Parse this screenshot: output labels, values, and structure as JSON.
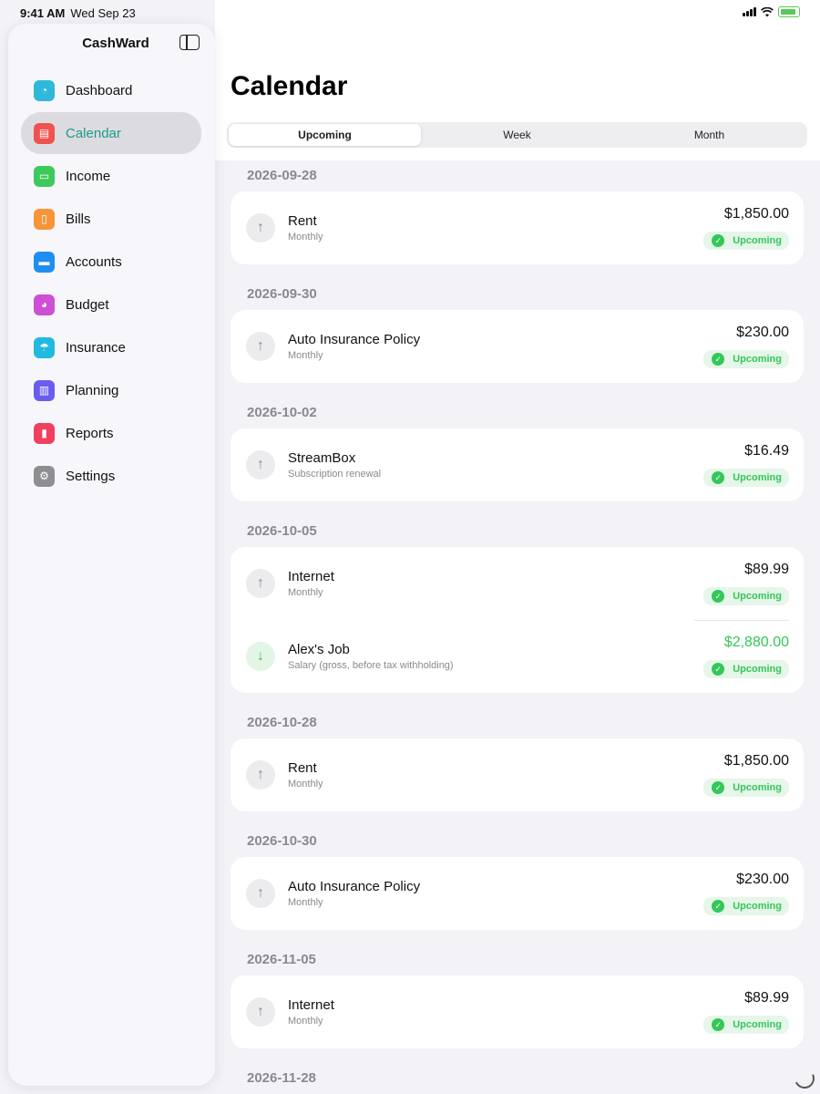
{
  "status": {
    "time": "9:41 AM",
    "date": "Wed Sep 23"
  },
  "app": {
    "name": "CashWard"
  },
  "page": {
    "title": "Calendar"
  },
  "segments": [
    "Upcoming",
    "Week",
    "Month"
  ],
  "selected_segment": "Upcoming",
  "sidebar": {
    "items": [
      {
        "label": "Dashboard",
        "icon": "gauge-icon",
        "color": "#2fb8d9",
        "glyph": "◔"
      },
      {
        "label": "Calendar",
        "icon": "calendar-icon",
        "color": "#f0524f",
        "glyph": "▤",
        "active": true
      },
      {
        "label": "Income",
        "icon": "banknote-icon",
        "color": "#3ec95c",
        "glyph": "▭"
      },
      {
        "label": "Bills",
        "icon": "document-icon",
        "color": "#f7943a",
        "glyph": "▯"
      },
      {
        "label": "Accounts",
        "icon": "credit-card-icon",
        "color": "#1f8ef0",
        "glyph": "▬"
      },
      {
        "label": "Budget",
        "icon": "pie-chart-icon",
        "color": "#cc4fd6",
        "glyph": "◕"
      },
      {
        "label": "Insurance",
        "icon": "umbrella-icon",
        "color": "#22b9e0",
        "glyph": "☂"
      },
      {
        "label": "Planning",
        "icon": "map-icon",
        "color": "#6a5cf0",
        "glyph": "▥"
      },
      {
        "label": "Reports",
        "icon": "bar-chart-icon",
        "color": "#f0405e",
        "glyph": "▮"
      },
      {
        "label": "Settings",
        "icon": "gear-icon",
        "color": "#8e8e93",
        "glyph": "⚙"
      }
    ]
  },
  "sections": [
    {
      "date": "2026-09-28",
      "rows": [
        {
          "name": "Rent",
          "sub": "Monthly",
          "amount": "$1,850.00",
          "status": "Upcoming",
          "direction": "out"
        }
      ]
    },
    {
      "date": "2026-09-30",
      "rows": [
        {
          "name": "Auto Insurance Policy",
          "sub": "Monthly",
          "amount": "$230.00",
          "status": "Upcoming",
          "direction": "out"
        }
      ]
    },
    {
      "date": "2026-10-02",
      "rows": [
        {
          "name": "StreamBox",
          "sub": "Subscription renewal",
          "amount": "$16.49",
          "status": "Upcoming",
          "direction": "out"
        }
      ]
    },
    {
      "date": "2026-10-05",
      "rows": [
        {
          "name": "Internet",
          "sub": "Monthly",
          "amount": "$89.99",
          "status": "Upcoming",
          "direction": "out"
        },
        {
          "name": "Alex's Job",
          "sub": "Salary (gross, before tax withholding)",
          "amount": "$2,880.00",
          "status": "Upcoming",
          "direction": "in"
        }
      ]
    },
    {
      "date": "2026-10-28",
      "rows": [
        {
          "name": "Rent",
          "sub": "Monthly",
          "amount": "$1,850.00",
          "status": "Upcoming",
          "direction": "out"
        }
      ]
    },
    {
      "date": "2026-10-30",
      "rows": [
        {
          "name": "Auto Insurance Policy",
          "sub": "Monthly",
          "amount": "$230.00",
          "status": "Upcoming",
          "direction": "out"
        }
      ]
    },
    {
      "date": "2026-11-05",
      "rows": [
        {
          "name": "Internet",
          "sub": "Monthly",
          "amount": "$89.99",
          "status": "Upcoming",
          "direction": "out"
        }
      ]
    },
    {
      "date": "2026-11-28",
      "rows": []
    }
  ],
  "colors": {
    "accent": "#1e9a8a",
    "success": "#34c759",
    "muted": "#8a8a8e"
  }
}
